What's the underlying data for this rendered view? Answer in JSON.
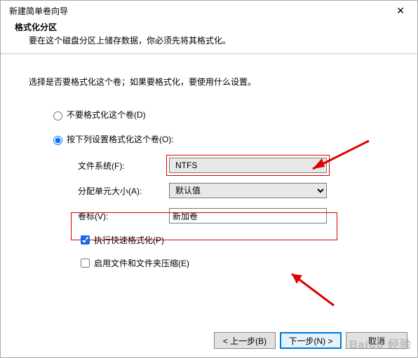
{
  "window": {
    "title": "新建简单卷向导"
  },
  "header": {
    "title": "格式化分区",
    "desc": "要在这个磁盘分区上储存数据，你必须先将其格式化。"
  },
  "instruction": "选择是否要格式化这个卷；如果要格式化，要使用什么设置。",
  "radios": {
    "noformat": "不要格式化这个卷(D)",
    "format": "按下列设置格式化这个卷(O):"
  },
  "fields": {
    "filesystem_label": "文件系统(F):",
    "filesystem_value": "NTFS",
    "allocation_label": "分配单元大小(A):",
    "allocation_value": "默认值",
    "volume_label": "卷标(V):",
    "volume_value": "新加卷"
  },
  "checks": {
    "quickformat": "执行快速格式化(P)",
    "compression": "启用文件和文件夹压缩(E)"
  },
  "buttons": {
    "back": "< 上一步(B)",
    "next": "下一步(N) >",
    "cancel": "取消"
  },
  "watermark": "Baidu 经验"
}
